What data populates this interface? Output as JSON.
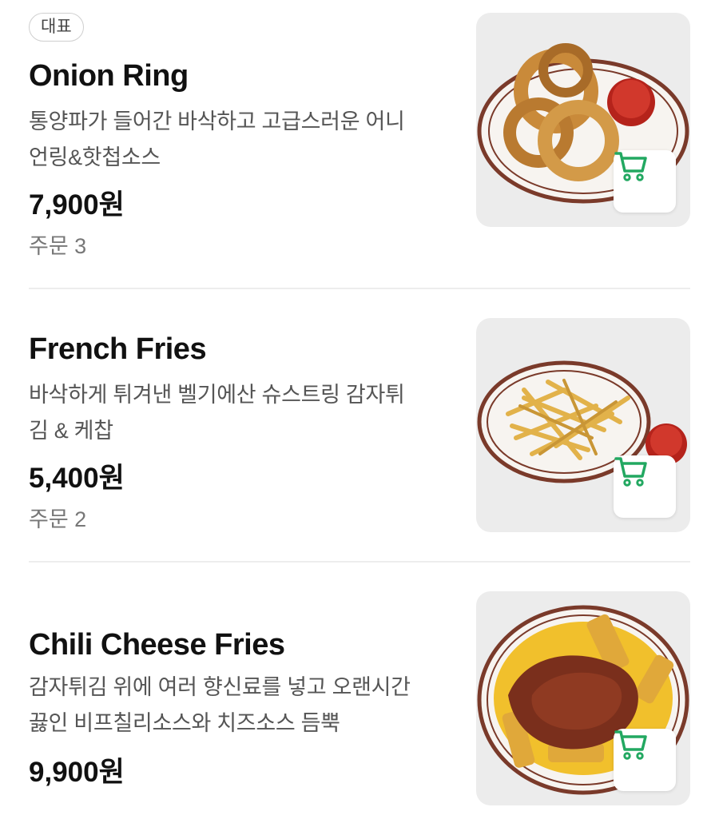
{
  "menu": {
    "items": [
      {
        "badge": "대표",
        "name": "Onion Ring",
        "desc_line1": "통양파가 들어간 바삭하고 고급스러운 어니",
        "desc_line2": "언링&핫첩소스",
        "price": "7,900원",
        "orders": "주문 3"
      },
      {
        "name": "French Fries",
        "desc_line1": "바삭하게 튀겨낸 벨기에산 슈스트링 감자튀",
        "desc_line2": "김 & 케찹",
        "price": "5,400원",
        "orders": "주문 2"
      },
      {
        "name": "Chili Cheese Fries",
        "desc_line1": "감자튀김 위에 여러 향신료를 넣고 오랜시간",
        "desc_line2": "끓인 비프칠리소스와 치즈소스 듬뿍",
        "price": "9,900원"
      }
    ]
  },
  "icons": {
    "cart": "shopping-cart-icon"
  },
  "colors": {
    "cart_green": "#22a861",
    "plate_rim": "#7a3a2a"
  }
}
